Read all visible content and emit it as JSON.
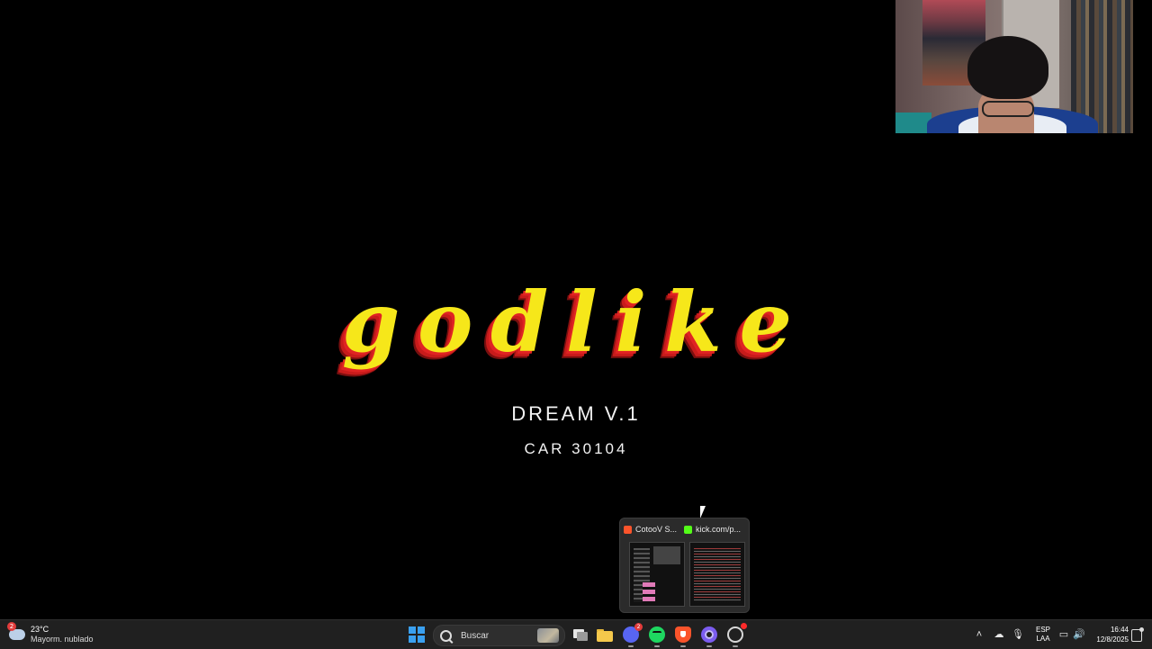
{
  "screen": {
    "title": "godlike",
    "subtitle": "DREAM V.1",
    "code": "CAR 30104"
  },
  "taskbar_preview": {
    "items": [
      {
        "label": "CotooV S...",
        "icon": "brave-icon"
      },
      {
        "label": "kick.com/p...",
        "icon": "kick-icon"
      }
    ]
  },
  "taskbar": {
    "weather": {
      "temp": "23°C",
      "condition": "Mayorm. nublado",
      "badge": "2"
    },
    "search_placeholder": "Buscar",
    "apps": [
      {
        "name": "windows-start",
        "icon": "windows-icon"
      },
      {
        "name": "task-view",
        "icon": "taskview-icon"
      },
      {
        "name": "file-explorer",
        "icon": "folder-icon"
      },
      {
        "name": "discord",
        "icon": "discord-icon",
        "badge": "2"
      },
      {
        "name": "spotify",
        "icon": "spotify-icon"
      },
      {
        "name": "brave",
        "icon": "brave-icon"
      },
      {
        "name": "app",
        "icon": "circle-app-icon"
      },
      {
        "name": "obs",
        "icon": "obs-icon"
      }
    ],
    "tray": {
      "language_line1": "ESP",
      "language_line2": "LAA",
      "time": "16:44",
      "date": "12/8/2025"
    }
  },
  "colors": {
    "title_fill": "#f6e71a",
    "title_shadow": "#e02323",
    "taskbar_bg": "#202020",
    "start_accent": "#3aa0f0"
  }
}
